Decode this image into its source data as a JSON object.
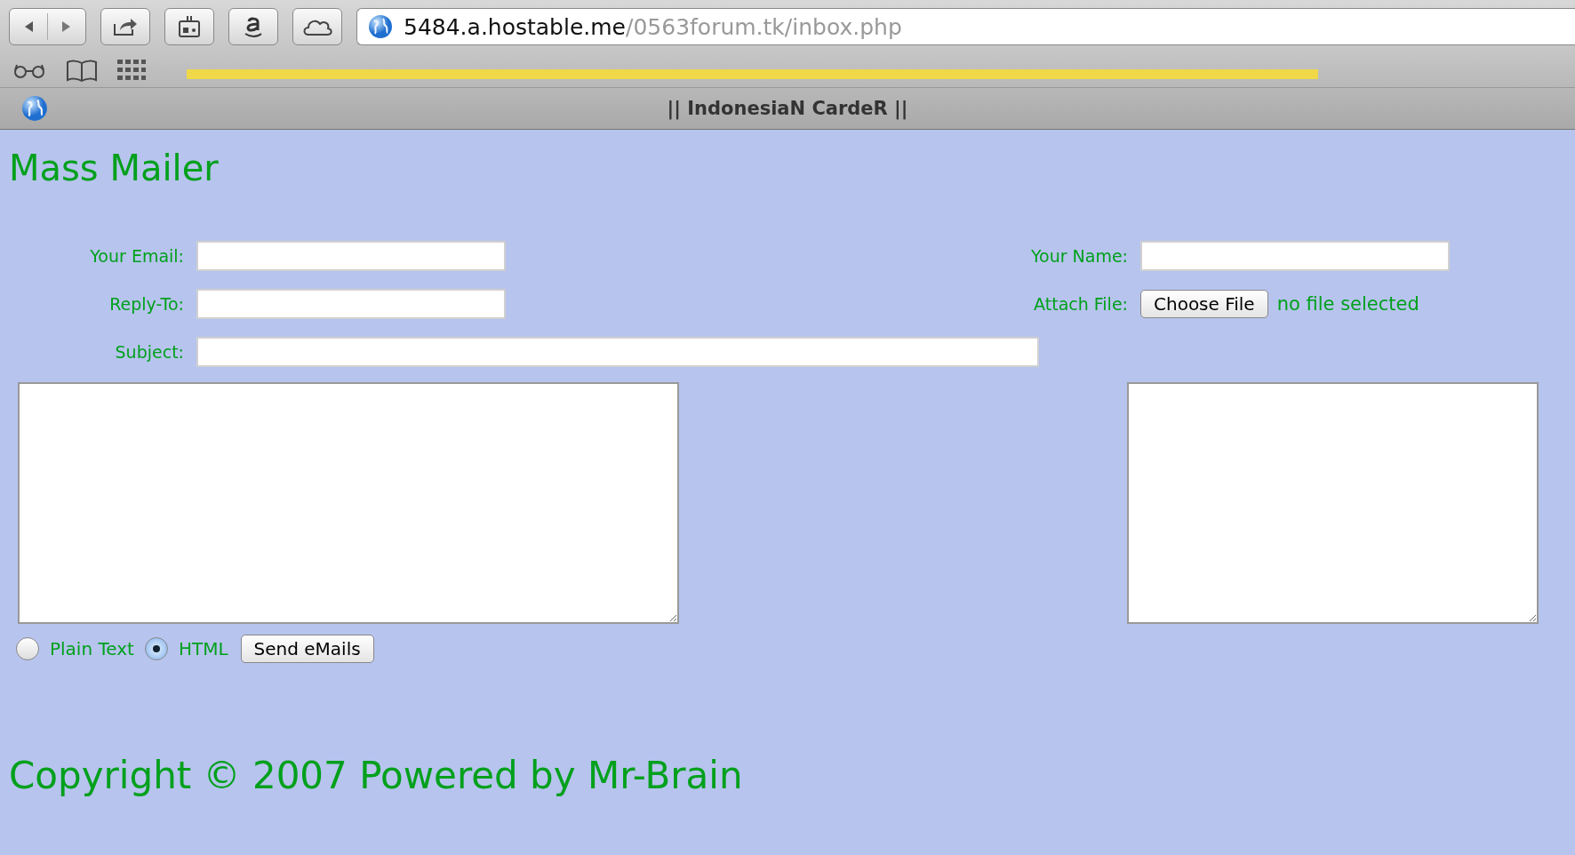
{
  "browser": {
    "address": {
      "host": "5484.a.hostable.me",
      "path": "/0563forum.tk/inbox.php"
    },
    "tab": {
      "title": "|| IndonesiaN CardeR ||"
    }
  },
  "page": {
    "title": "Mass Mailer",
    "fields": [
      {
        "label": "Your Email:",
        "kind": "text"
      },
      {
        "label": "Your Name:",
        "kind": "text"
      },
      {
        "label": "Reply-To:",
        "kind": "text"
      },
      {
        "label": "Attach File:",
        "kind": "file",
        "button": "Choose File",
        "status": "no file selected"
      },
      {
        "label": "Subject:",
        "kind": "wide"
      }
    ],
    "formats": [
      {
        "label": "Plain Text",
        "selected": false
      },
      {
        "label": "HTML",
        "selected": true
      }
    ],
    "send_button": "Send eMails",
    "footer": "Copyright © 2007 Powered by Mr-Brain"
  }
}
